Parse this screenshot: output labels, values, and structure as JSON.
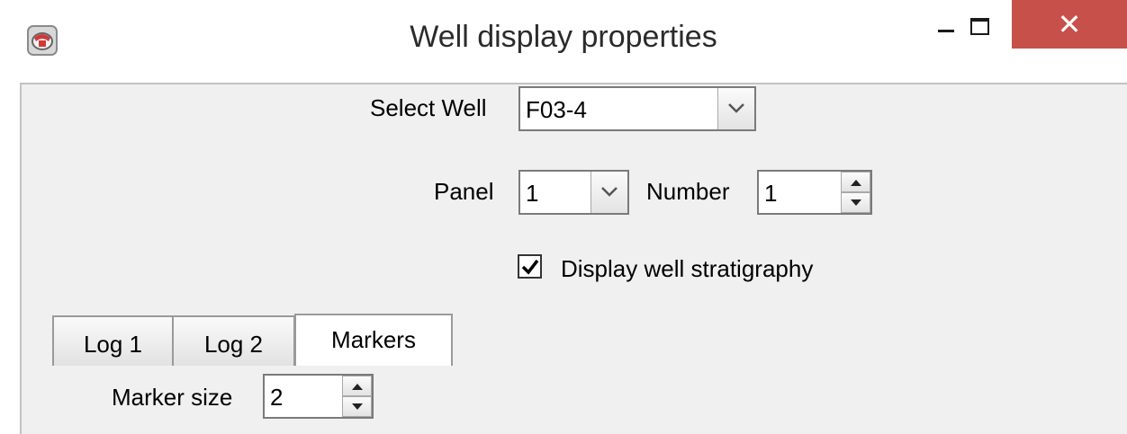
{
  "window": {
    "title": "Well display properties",
    "close_glyph": "✕",
    "accent_close": "#c7504b"
  },
  "form": {
    "select_well_label": "Select Well",
    "select_well_value": "F03-4",
    "panel_label": "Panel",
    "panel_value": "1",
    "number_label": "Number",
    "number_value": "1",
    "stratigraphy_label": "Display well stratigraphy",
    "stratigraphy_checked": true
  },
  "tabs": [
    {
      "label": "Log 1",
      "active": false
    },
    {
      "label": "Log 2",
      "active": false
    },
    {
      "label": "Markers",
      "active": true
    }
  ],
  "markers": {
    "marker_size_label": "Marker size",
    "marker_size_value": "2"
  },
  "icons": {
    "app": "app-logo-icon",
    "dropdown": "chevron-down-icon",
    "spin_up": "arrow-up-icon",
    "spin_down": "arrow-down-icon",
    "check": "checkmark-icon"
  }
}
